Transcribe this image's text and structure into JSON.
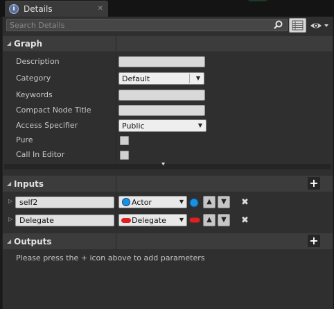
{
  "tab": {
    "title": "Details",
    "icon": "info-icon"
  },
  "search": {
    "placeholder": "Search Details"
  },
  "sections": {
    "graph": "Graph",
    "inputs": "Inputs",
    "outputs": "Outputs"
  },
  "graph": {
    "description": {
      "label": "Description",
      "value": ""
    },
    "category": {
      "label": "Category",
      "value": "Default"
    },
    "keywords": {
      "label": "Keywords",
      "value": ""
    },
    "compact_node_title": {
      "label": "Compact Node Title",
      "value": ""
    },
    "access_specifier": {
      "label": "Access Specifier",
      "value": "Public"
    },
    "pure": {
      "label": "Pure",
      "checked": false
    },
    "call_in_editor": {
      "label": "Call In Editor",
      "checked": false
    }
  },
  "inputs": [
    {
      "name": "self2",
      "type": "Actor",
      "pin": "circle",
      "pin_color": "#1a8fe3"
    },
    {
      "name": "Delegate",
      "type": "Delegate",
      "pin": "pill",
      "pin_color": "#e02020"
    }
  ],
  "outputs": {
    "hint": "Please press the + icon above to add parameters"
  },
  "colors": {
    "panel": "#2f2f2f",
    "section_header": "#3c3c3c",
    "background": "#1a1a1a"
  }
}
